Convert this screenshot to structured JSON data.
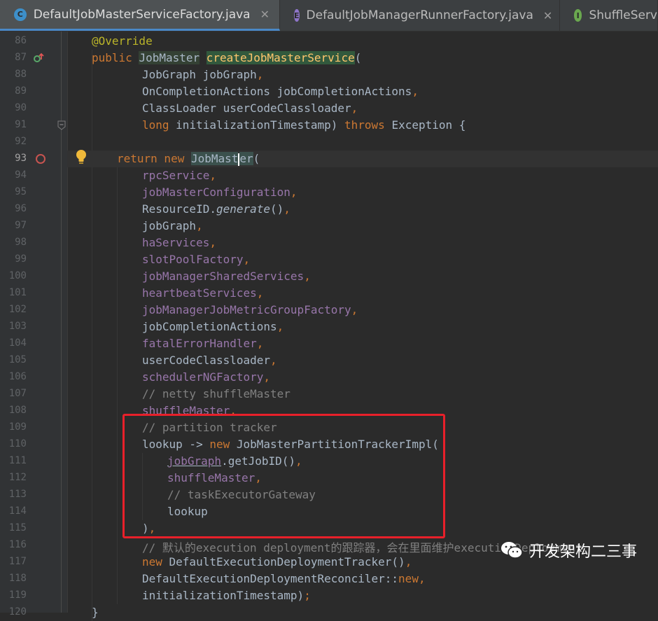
{
  "tabs": [
    {
      "label": "DefaultJobMasterServiceFactory.java",
      "icon": "C",
      "icon_name": "class-icon",
      "active": true,
      "close": "✕"
    },
    {
      "label": "DefaultJobManagerRunnerFactory.java",
      "icon": "E",
      "icon_name": "enum-icon",
      "active": false,
      "close": "✕"
    },
    {
      "label": "ShuffleServ",
      "icon": "I",
      "icon_name": "interface-icon",
      "active": false,
      "close": ""
    }
  ],
  "watermark": {
    "text": "开发架构二三事",
    "icon": "wechat-icon"
  },
  "colors": {
    "keyword": "#cc7832",
    "annotation": "#bbb529",
    "field": "#9876aa",
    "comment": "#808080",
    "method": "#ffc66d",
    "text": "#a9b7c6",
    "highlight_box": "#e8202a",
    "tab_accent": "#4a88c7"
  },
  "lines": [
    {
      "num": "86",
      "indent": 0,
      "tokens": [
        {
          "t": "@Override",
          "c": "an"
        }
      ]
    },
    {
      "num": "87",
      "indent": 0,
      "icon": "override-arrow",
      "tokens": [
        {
          "t": "public ",
          "c": "kw"
        },
        {
          "t": "JobMaster",
          "c": "hl"
        },
        {
          "t": " "
        },
        {
          "t": "createJobMasterService",
          "c": "fn hl-green"
        },
        {
          "t": "("
        }
      ]
    },
    {
      "num": "88",
      "indent": 2,
      "tokens": [
        {
          "t": "JobGraph jobGraph"
        },
        {
          "t": ",",
          "c": "kw"
        }
      ]
    },
    {
      "num": "89",
      "indent": 2,
      "tokens": [
        {
          "t": "OnCompletionActions jobCompletionActions"
        },
        {
          "t": ",",
          "c": "kw"
        }
      ]
    },
    {
      "num": "90",
      "indent": 2,
      "tokens": [
        {
          "t": "ClassLoader userCodeClassloader"
        },
        {
          "t": ",",
          "c": "kw"
        }
      ]
    },
    {
      "num": "91",
      "indent": 2,
      "fold": true,
      "tokens": [
        {
          "t": "long ",
          "c": "kw"
        },
        {
          "t": "initializationTimestamp) "
        },
        {
          "t": "throws ",
          "c": "kw"
        },
        {
          "t": "Exception {"
        }
      ]
    },
    {
      "num": "92",
      "indent": 0,
      "tokens": []
    },
    {
      "num": "93",
      "indent": 1,
      "current": true,
      "breakpoint": true,
      "bulb": true,
      "tokens": [
        {
          "t": "return new ",
          "c": "kw"
        },
        {
          "t": "JobMast",
          "c": "hl2"
        },
        {
          "t": "|",
          "c": "cursor"
        },
        {
          "t": "er",
          "c": "hl2"
        },
        {
          "t": "("
        }
      ]
    },
    {
      "num": "94",
      "indent": 2,
      "tokens": [
        {
          "t": "rpcService",
          "c": "fld"
        },
        {
          "t": ",",
          "c": "kw"
        }
      ]
    },
    {
      "num": "95",
      "indent": 2,
      "tokens": [
        {
          "t": "jobMasterConfiguration",
          "c": "fld"
        },
        {
          "t": ",",
          "c": "kw"
        }
      ]
    },
    {
      "num": "96",
      "indent": 2,
      "tokens": [
        {
          "t": "ResourceID."
        },
        {
          "t": "generate",
          "c": "it"
        },
        {
          "t": "()"
        },
        {
          "t": ",",
          "c": "kw"
        }
      ]
    },
    {
      "num": "97",
      "indent": 2,
      "tokens": [
        {
          "t": "jobGraph"
        },
        {
          "t": ",",
          "c": "kw"
        }
      ]
    },
    {
      "num": "98",
      "indent": 2,
      "tokens": [
        {
          "t": "haServices",
          "c": "fld"
        },
        {
          "t": ",",
          "c": "kw"
        }
      ]
    },
    {
      "num": "99",
      "indent": 2,
      "tokens": [
        {
          "t": "slotPoolFactory",
          "c": "fld"
        },
        {
          "t": ",",
          "c": "kw"
        }
      ]
    },
    {
      "num": "100",
      "indent": 2,
      "tokens": [
        {
          "t": "jobManagerSharedServices",
          "c": "fld"
        },
        {
          "t": ",",
          "c": "kw"
        }
      ]
    },
    {
      "num": "101",
      "indent": 2,
      "tokens": [
        {
          "t": "heartbeatServices",
          "c": "fld"
        },
        {
          "t": ",",
          "c": "kw"
        }
      ]
    },
    {
      "num": "102",
      "indent": 2,
      "tokens": [
        {
          "t": "jobManagerJobMetricGroupFactory",
          "c": "fld"
        },
        {
          "t": ",",
          "c": "kw"
        }
      ]
    },
    {
      "num": "103",
      "indent": 2,
      "tokens": [
        {
          "t": "jobCompletionActions"
        },
        {
          "t": ",",
          "c": "kw"
        }
      ]
    },
    {
      "num": "104",
      "indent": 2,
      "tokens": [
        {
          "t": "fatalErrorHandler",
          "c": "fld"
        },
        {
          "t": ",",
          "c": "kw"
        }
      ]
    },
    {
      "num": "105",
      "indent": 2,
      "tokens": [
        {
          "t": "userCodeClassloader"
        },
        {
          "t": ",",
          "c": "kw"
        }
      ]
    },
    {
      "num": "106",
      "indent": 2,
      "tokens": [
        {
          "t": "schedulerNGFactory",
          "c": "fld"
        },
        {
          "t": ",",
          "c": "kw"
        }
      ]
    },
    {
      "num": "107",
      "indent": 2,
      "tokens": [
        {
          "t": "// netty shuffleMaster",
          "c": "cm"
        }
      ]
    },
    {
      "num": "108",
      "indent": 2,
      "tokens": [
        {
          "t": "shuffleMaster",
          "c": "fld"
        },
        {
          "t": ",",
          "c": "kw"
        }
      ]
    },
    {
      "num": "109",
      "indent": 2,
      "tokens": [
        {
          "t": "// partition tracker",
          "c": "cm"
        }
      ]
    },
    {
      "num": "110",
      "indent": 2,
      "tokens": [
        {
          "t": "lookup -> "
        },
        {
          "t": "new ",
          "c": "kw"
        },
        {
          "t": "JobMasterPartitionTrackerImpl("
        }
      ]
    },
    {
      "num": "111",
      "indent": 3,
      "tokens": [
        {
          "t": "jobGraph",
          "c": "fld ul"
        },
        {
          "t": ".getJobID()"
        },
        {
          "t": ",",
          "c": "kw"
        }
      ]
    },
    {
      "num": "112",
      "indent": 3,
      "tokens": [
        {
          "t": "shuffleMaster",
          "c": "fld"
        },
        {
          "t": ",",
          "c": "kw"
        }
      ]
    },
    {
      "num": "113",
      "indent": 3,
      "tokens": [
        {
          "t": "// taskExecutorGateway",
          "c": "cm"
        }
      ]
    },
    {
      "num": "114",
      "indent": 3,
      "tokens": [
        {
          "t": "lookup"
        }
      ]
    },
    {
      "num": "115",
      "indent": 2,
      "tokens": [
        {
          "t": ")"
        },
        {
          "t": ",",
          "c": "kw"
        }
      ]
    },
    {
      "num": "116",
      "indent": 2,
      "tokens": [
        {
          "t": "// 默认的execution deployment的跟踪器，会在里面维护executionDeployment",
          "c": "cm"
        }
      ]
    },
    {
      "num": "117",
      "indent": 2,
      "tokens": [
        {
          "t": "new ",
          "c": "kw"
        },
        {
          "t": "DefaultExecutionDeploymentTracker()"
        },
        {
          "t": ",",
          "c": "kw"
        }
      ]
    },
    {
      "num": "118",
      "indent": 2,
      "tokens": [
        {
          "t": "DefaultExecutionDeploymentReconciler::"
        },
        {
          "t": "new",
          "c": "kw"
        },
        {
          "t": ",",
          "c": "kw"
        }
      ]
    },
    {
      "num": "119",
      "indent": 2,
      "tokens": [
        {
          "t": "initializationTimestamp)"
        },
        {
          "t": ";",
          "c": "kw"
        }
      ]
    },
    {
      "num": "120",
      "indent": 0,
      "tokens": [
        {
          "t": "}"
        }
      ]
    }
  ]
}
